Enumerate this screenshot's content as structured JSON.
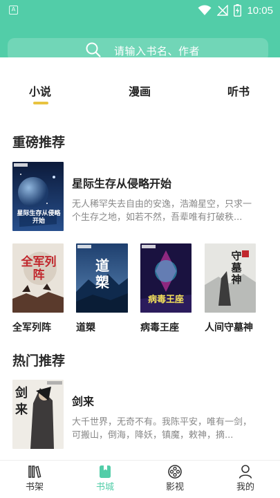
{
  "status": {
    "time": "10:05",
    "app_badge": "A"
  },
  "search": {
    "placeholder": "请输入书名、作者"
  },
  "tabs": [
    {
      "label": "小说",
      "active": true
    },
    {
      "label": "漫画",
      "active": false
    },
    {
      "label": "听书",
      "active": false
    }
  ],
  "featured": {
    "title": "重磅推荐",
    "main_book": {
      "title": "星际生存从侵略开始",
      "desc": "无人稀罕失去自由的安逸，浩瀚星空，只求一个生存之地，如若不然，吾辈唯有打破秩...",
      "cover_text": "星际生存从侵略开始"
    },
    "grid": [
      {
        "title": "全军列阵",
        "cover_text": "全军列阵"
      },
      {
        "title": "道槊",
        "cover_text": "道槊"
      },
      {
        "title": "病毒王座",
        "cover_text": "病毒王座"
      },
      {
        "title": "人间守墓神",
        "cover_text": "守墓神"
      }
    ]
  },
  "hot": {
    "title": "热门推荐",
    "main_book": {
      "title": "剑来",
      "desc": "大千世界，无奇不有。我陈平安，唯有一剑，可搬山，倒海，降妖，镇魔，敕神，摘...",
      "cover_text": "剑来"
    }
  },
  "bottom_nav": [
    {
      "label": "书架",
      "icon": "bookshelf-icon",
      "active": false
    },
    {
      "label": "书城",
      "icon": "bookstore-icon",
      "active": true
    },
    {
      "label": "影视",
      "icon": "film-reel-icon",
      "active": false
    },
    {
      "label": "我的",
      "icon": "user-icon",
      "active": false
    }
  ],
  "colors": {
    "accent": "#52cda8",
    "tab_indicator": "#e8c340"
  }
}
